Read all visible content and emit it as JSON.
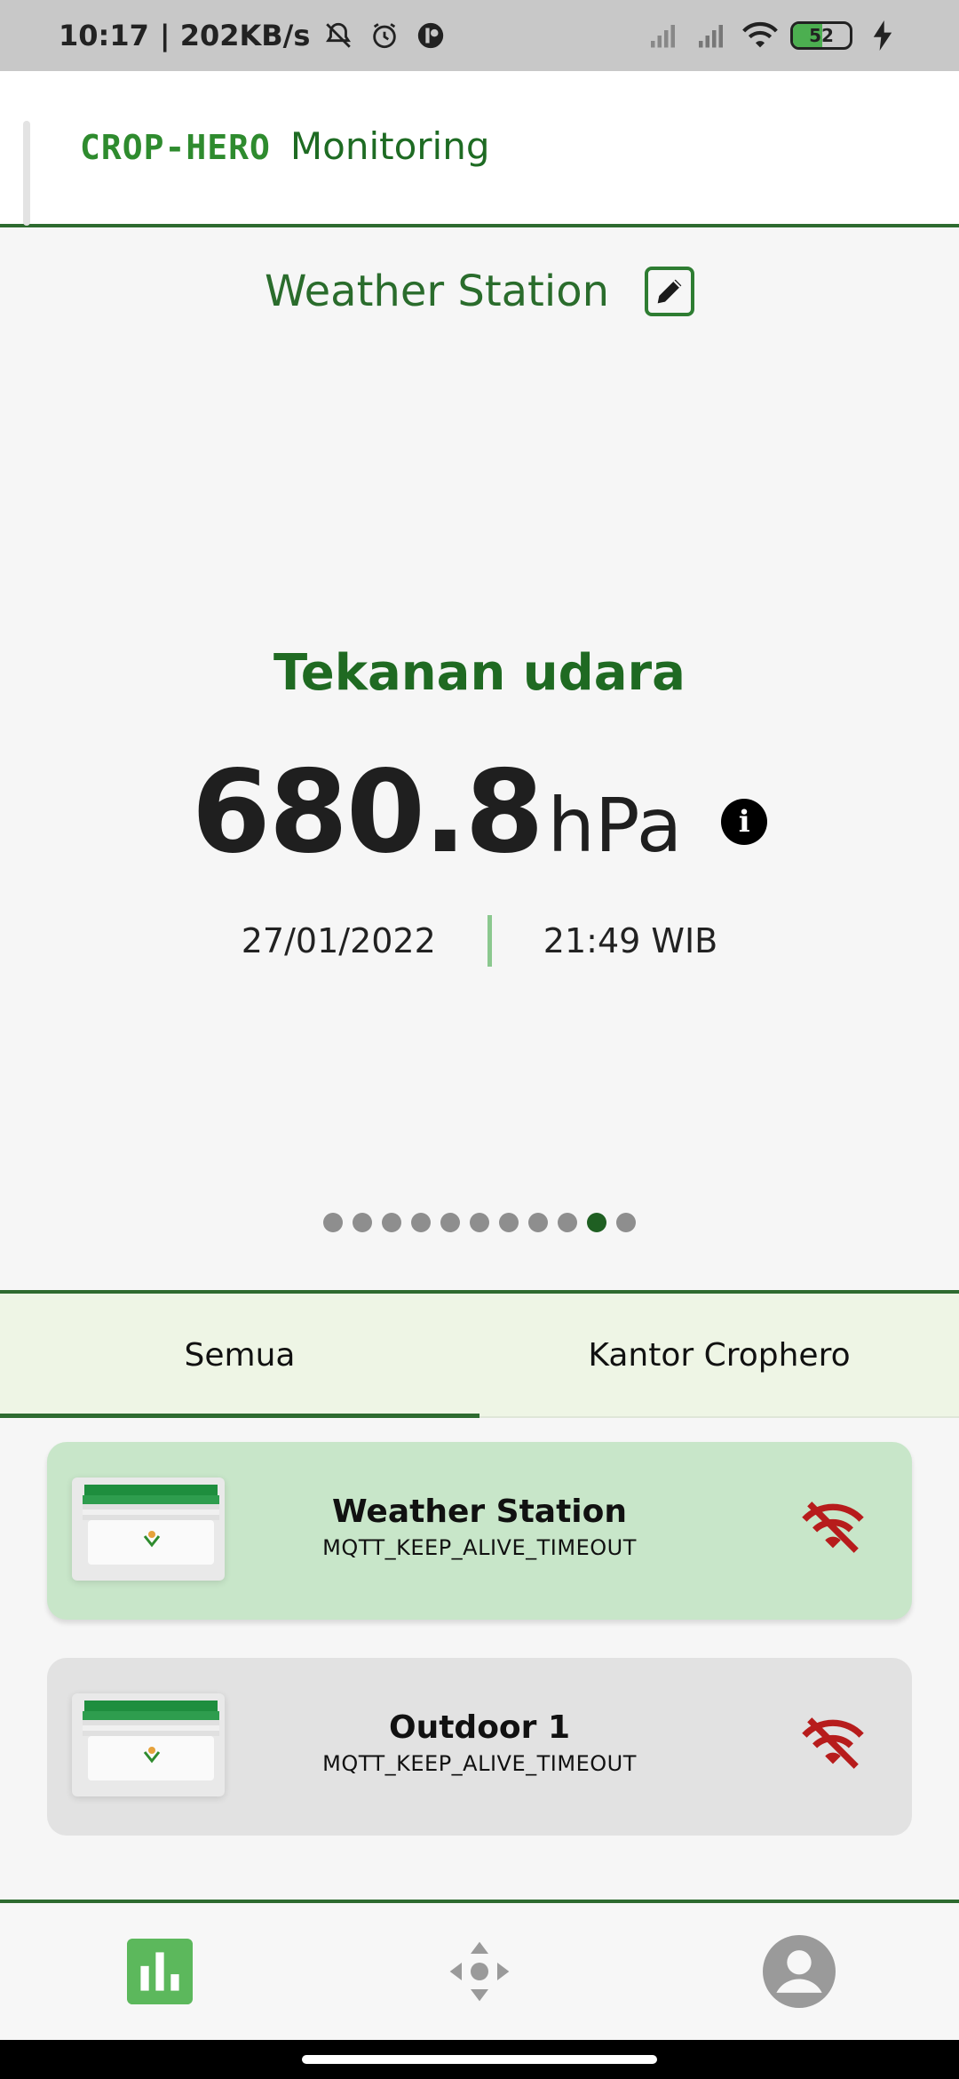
{
  "status_bar": {
    "time": "10:17",
    "net_speed": "| 202KB/s",
    "battery_level": "52",
    "battery_fraction": 0.52
  },
  "app_bar": {
    "logo_text": "CROP-HERO",
    "title": "Monitoring"
  },
  "station": {
    "title": "Weather Station",
    "edit_icon": "pencil-square-icon"
  },
  "reading": {
    "label": "Tekanan udara",
    "value": "680.8",
    "unit": "hPa",
    "info_icon": "i",
    "date": "27/01/2022",
    "time": "21:49 WIB"
  },
  "pager": {
    "total": 11,
    "active_index": 9
  },
  "tabs": [
    {
      "label": "Semua",
      "active": true
    },
    {
      "label": "Kantor Crophero",
      "active": false
    }
  ],
  "devices": [
    {
      "name": "Weather Station",
      "status": "MQTT_KEEP_ALIVE_TIMEOUT",
      "selected": true,
      "icon": "wifi-off-icon"
    },
    {
      "name": "Outdoor 1",
      "status": "MQTT_KEEP_ALIVE_TIMEOUT",
      "selected": false,
      "icon": "wifi-off-icon"
    }
  ],
  "bottom_nav": [
    {
      "name": "dashboard",
      "icon": "bar-chart-icon",
      "active": true
    },
    {
      "name": "control",
      "icon": "move-arrows-icon",
      "active": false
    },
    {
      "name": "profile",
      "icon": "account-circle-icon",
      "active": false
    }
  ],
  "colors": {
    "brand_green": "#2e6b30",
    "accent_green": "#5cb85c",
    "selected_card": "#c8e6c9",
    "offline_red": "#b71c1c"
  }
}
